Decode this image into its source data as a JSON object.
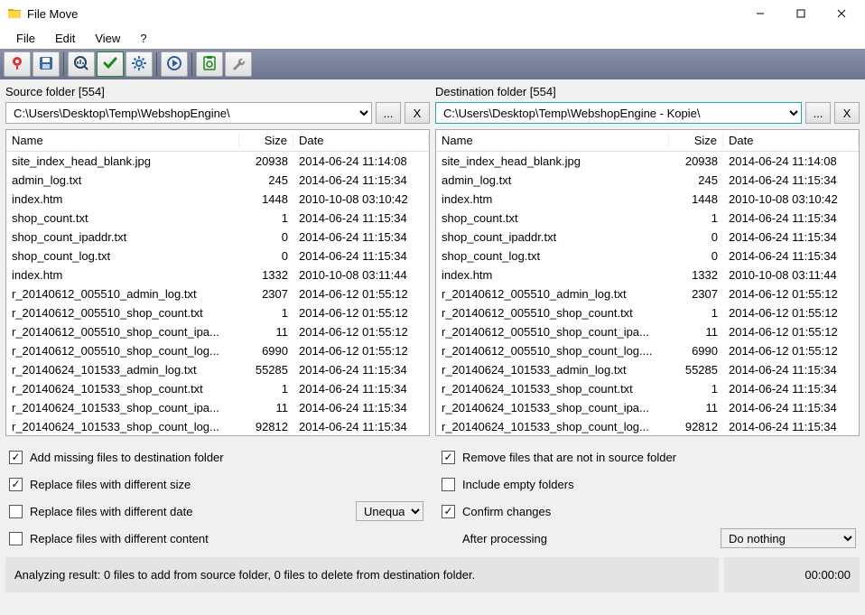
{
  "app": {
    "title": "File Move"
  },
  "menu": {
    "file": "File",
    "edit": "Edit",
    "view": "View",
    "help": "?"
  },
  "source": {
    "label": "Source folder [554]",
    "path": "C:\\Users\\Desktop\\Temp\\WebshopEngine\\",
    "browse": "...",
    "clear": "X",
    "cols": {
      "name": "Name",
      "size": "Size",
      "date": "Date"
    },
    "rows": [
      {
        "name": "site_index_head_blank.jpg",
        "size": "20938",
        "date": "2014-06-24 11:14:08"
      },
      {
        "name": "admin_log.txt",
        "size": "245",
        "date": "2014-06-24 11:15:34"
      },
      {
        "name": "index.htm",
        "size": "1448",
        "date": "2010-10-08 03:10:42"
      },
      {
        "name": "shop_count.txt",
        "size": "1",
        "date": "2014-06-24 11:15:34"
      },
      {
        "name": "shop_count_ipaddr.txt",
        "size": "0",
        "date": "2014-06-24 11:15:34"
      },
      {
        "name": "shop_count_log.txt",
        "size": "0",
        "date": "2014-06-24 11:15:34"
      },
      {
        "name": "index.htm",
        "size": "1332",
        "date": "2010-10-08 03:11:44"
      },
      {
        "name": "r_20140612_005510_admin_log.txt",
        "size": "2307",
        "date": "2014-06-12 01:55:12"
      },
      {
        "name": "r_20140612_005510_shop_count.txt",
        "size": "1",
        "date": "2014-06-12 01:55:12"
      },
      {
        "name": "r_20140612_005510_shop_count_ipa...",
        "size": "11",
        "date": "2014-06-12 01:55:12"
      },
      {
        "name": "r_20140612_005510_shop_count_log...",
        "size": "6990",
        "date": "2014-06-12 01:55:12"
      },
      {
        "name": "r_20140624_101533_admin_log.txt",
        "size": "55285",
        "date": "2014-06-24 11:15:34"
      },
      {
        "name": "r_20140624_101533_shop_count.txt",
        "size": "1",
        "date": "2014-06-24 11:15:34"
      },
      {
        "name": "r_20140624_101533_shop_count_ipa...",
        "size": "11",
        "date": "2014-06-24 11:15:34"
      },
      {
        "name": "r_20140624_101533_shop_count_log...",
        "size": "92812",
        "date": "2014-06-24 11:15:34"
      }
    ]
  },
  "dest": {
    "label": "Destination folder [554]",
    "path": "C:\\Users\\Desktop\\Temp\\WebshopEngine - Kopie\\",
    "browse": "...",
    "clear": "X",
    "cols": {
      "name": "Name",
      "size": "Size",
      "date": "Date"
    },
    "rows": [
      {
        "name": "site_index_head_blank.jpg",
        "size": "20938",
        "date": "2014-06-24 11:14:08"
      },
      {
        "name": "admin_log.txt",
        "size": "245",
        "date": "2014-06-24 11:15:34"
      },
      {
        "name": "index.htm",
        "size": "1448",
        "date": "2010-10-08 03:10:42"
      },
      {
        "name": "shop_count.txt",
        "size": "1",
        "date": "2014-06-24 11:15:34"
      },
      {
        "name": "shop_count_ipaddr.txt",
        "size": "0",
        "date": "2014-06-24 11:15:34"
      },
      {
        "name": "shop_count_log.txt",
        "size": "0",
        "date": "2014-06-24 11:15:34"
      },
      {
        "name": "index.htm",
        "size": "1332",
        "date": "2010-10-08 03:11:44"
      },
      {
        "name": "r_20140612_005510_admin_log.txt",
        "size": "2307",
        "date": "2014-06-12 01:55:12"
      },
      {
        "name": "r_20140612_005510_shop_count.txt",
        "size": "1",
        "date": "2014-06-12 01:55:12"
      },
      {
        "name": "r_20140612_005510_shop_count_ipa...",
        "size": "11",
        "date": "2014-06-12 01:55:12"
      },
      {
        "name": "r_20140612_005510_shop_count_log....",
        "size": "6990",
        "date": "2014-06-12 01:55:12"
      },
      {
        "name": "r_20140624_101533_admin_log.txt",
        "size": "55285",
        "date": "2014-06-24 11:15:34"
      },
      {
        "name": "r_20140624_101533_shop_count.txt",
        "size": "1",
        "date": "2014-06-24 11:15:34"
      },
      {
        "name": "r_20140624_101533_shop_count_ipa...",
        "size": "11",
        "date": "2014-06-24 11:15:34"
      },
      {
        "name": "r_20140624_101533_shop_count_log...",
        "size": "92812",
        "date": "2014-06-24 11:15:34"
      }
    ]
  },
  "opts": {
    "add_missing": "Add missing files to destination folder",
    "replace_size": "Replace files with different size",
    "replace_date": "Replace files with different date",
    "replace_content": "Replace files with different content",
    "date_op": "Unequal",
    "remove_not_in_source": "Remove files that are not in source folder",
    "include_empty": "Include empty folders",
    "confirm": "Confirm changes",
    "after_label": "After processing",
    "after_value": "Do nothing"
  },
  "status": {
    "text": "Analyzing result: 0 files to add from source folder, 0 files to delete from destination folder.",
    "time": "00:00:00"
  }
}
